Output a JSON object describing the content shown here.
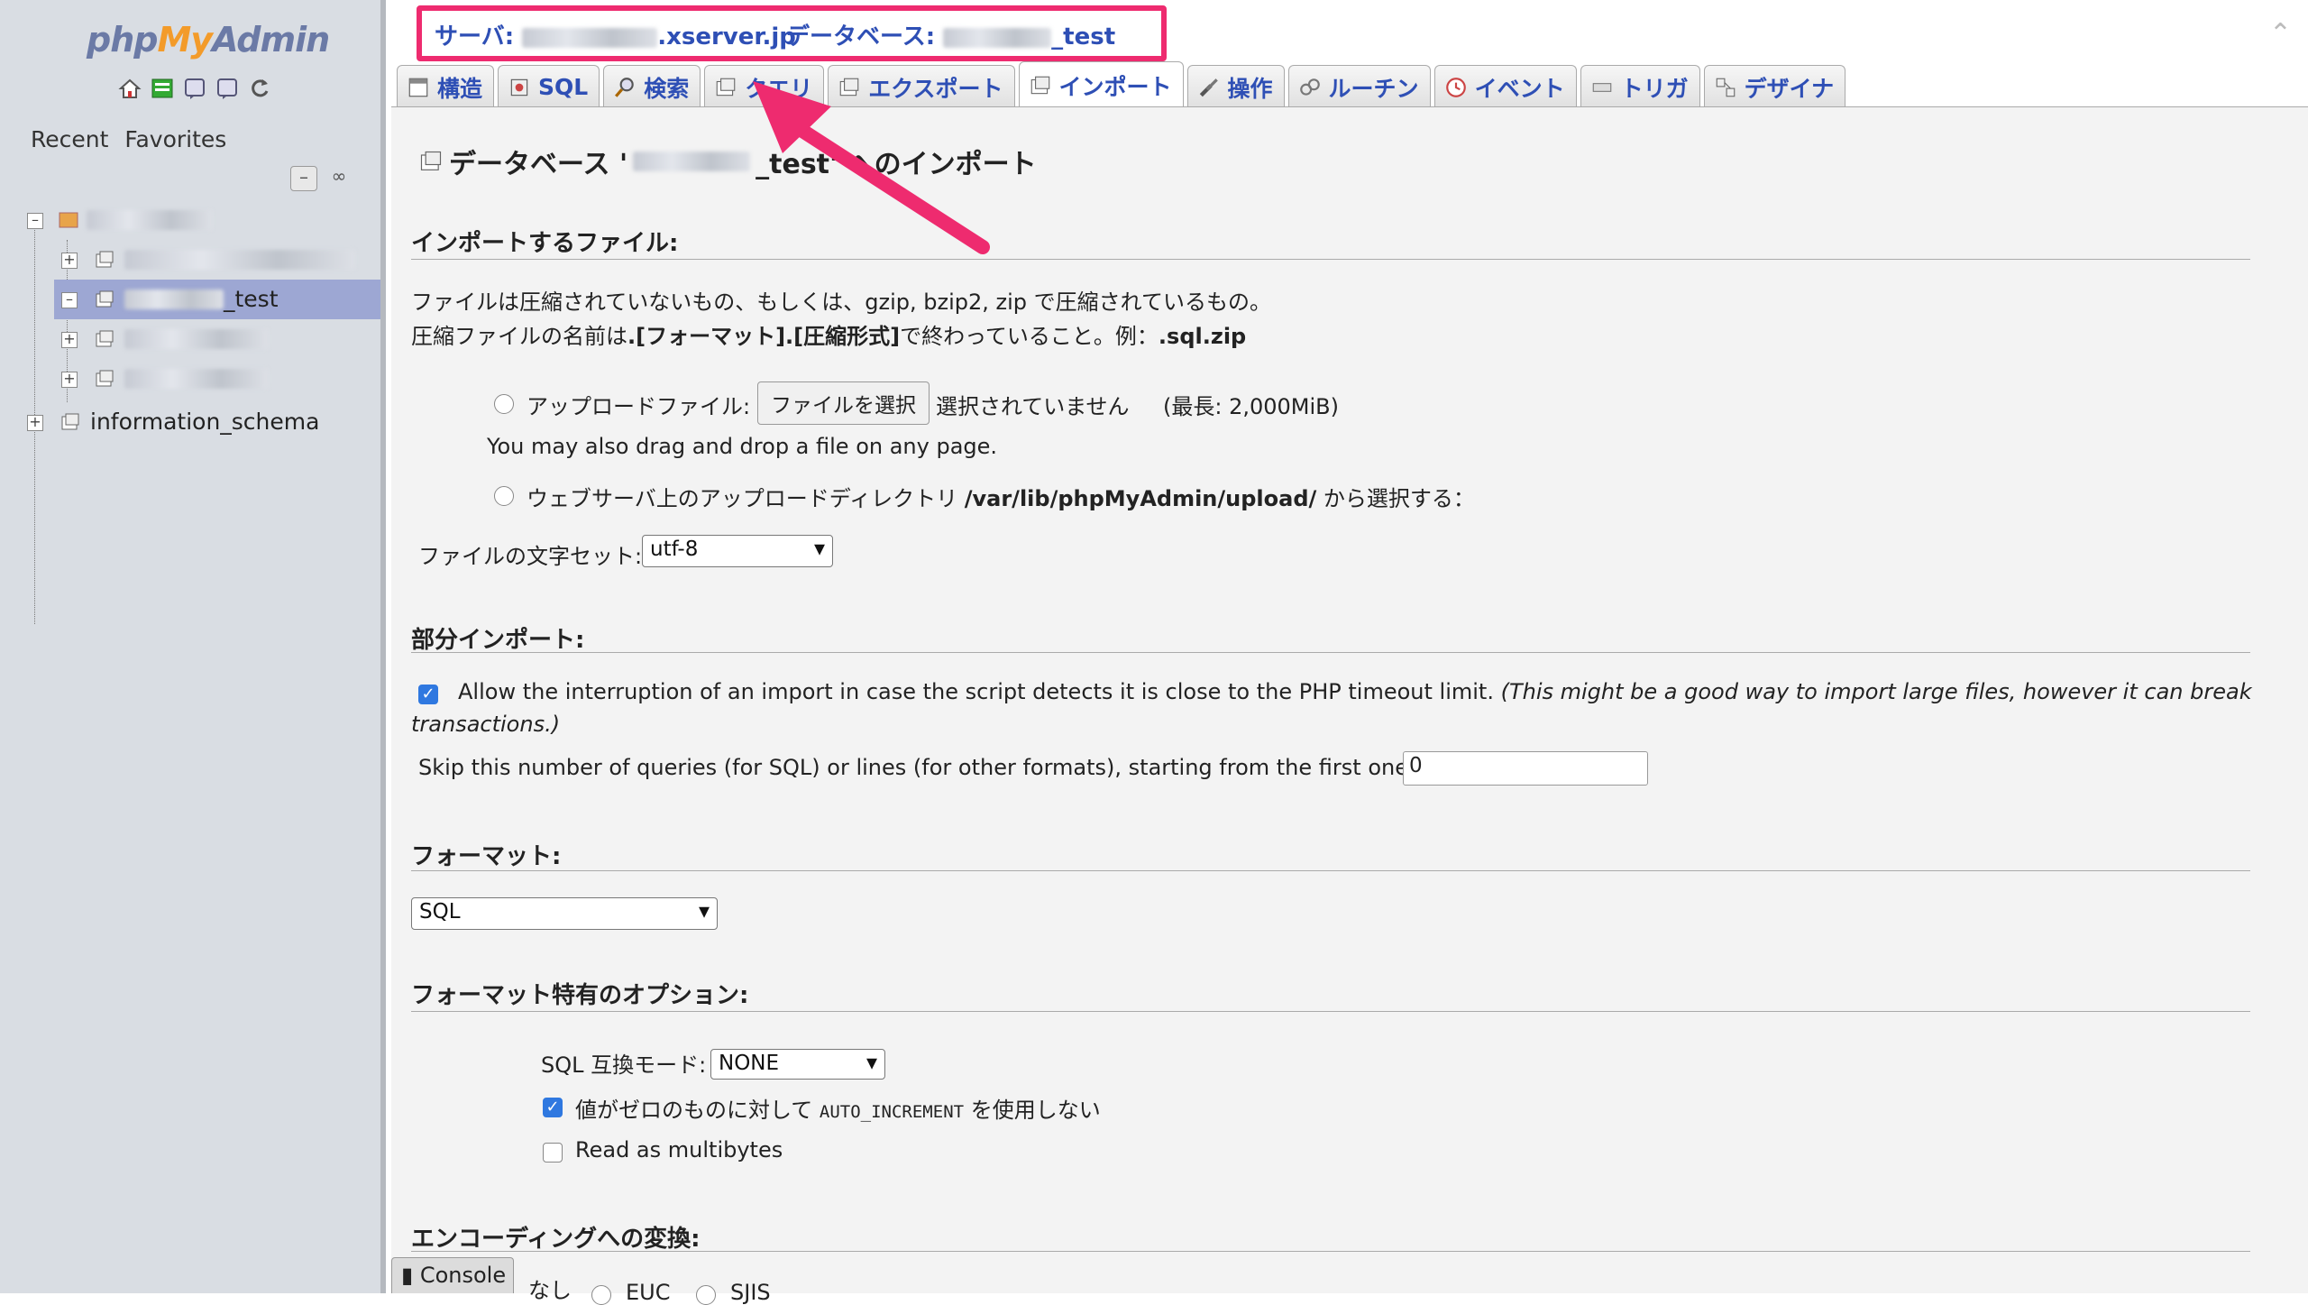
{
  "sidebar": {
    "logo": {
      "php": "php",
      "my": "My",
      "admin": "Admin"
    },
    "nav_icons": [
      "home-icon",
      "sql-query-icon",
      "docs-icon",
      "docs-icon-2",
      "reload-icon"
    ],
    "tabs": {
      "recent": "Recent",
      "favorites": "Favorites"
    },
    "tree": {
      "items": [
        {
          "label": "",
          "blurred": true
        },
        {
          "label": "",
          "blurred": true
        },
        {
          "label": "_test",
          "blurred_prefix": true,
          "selected": true
        },
        {
          "label": "",
          "blurred": true
        },
        {
          "label": "",
          "blurred": true
        },
        {
          "label": "information_schema"
        }
      ]
    }
  },
  "breadcrumb": {
    "server_label": "サーバ: ",
    "server_suffix": ".xserver.jp",
    "db_label": "データベース: ",
    "db_suffix": "_test"
  },
  "tabs": [
    {
      "label": "構造",
      "icon": "structure-icon"
    },
    {
      "label": "SQL",
      "icon": "sql-icon"
    },
    {
      "label": "検索",
      "icon": "search-icon"
    },
    {
      "label": "クエリ",
      "icon": "query-icon"
    },
    {
      "label": "エクスポート",
      "icon": "export-icon"
    },
    {
      "label": "インポート",
      "icon": "import-icon",
      "active": true
    },
    {
      "label": "操作",
      "icon": "operations-icon"
    },
    {
      "label": "ルーチン",
      "icon": "routines-icon"
    },
    {
      "label": "イベント",
      "icon": "events-icon"
    },
    {
      "label": "トリガ",
      "icon": "triggers-icon"
    },
    {
      "label": "デザイナ",
      "icon": "designer-icon"
    }
  ],
  "main": {
    "title_prefix": "データベース '",
    "title_suffix": "_test' へのインポート",
    "file_section": {
      "heading": "インポートするファイル:",
      "line1": "ファイルは圧縮されていないもの、もしくは、gzip, bzip2, zip で圧縮されているもの。",
      "line2_a": "圧縮ファイルの名前は",
      "line2_b": ".[フォーマット].[圧縮形式]",
      "line2_c": "で終わっていること。例：",
      "line2_d": ".sql.zip",
      "upload_label": "アップロードファイル:",
      "choose_file_button": "ファイルを選択",
      "no_file_selected": "選択されていません",
      "max_size": "(最長: 2,000MiB)",
      "drag_drop": "You may also drag and drop a file on any page.",
      "webserver_label_a": "ウェブサーバ上のアップロードディレクトリ",
      "webserver_path": "/var/lib/phpMyAdmin/upload/",
      "webserver_label_b": "から選択する：",
      "charset_label": "ファイルの文字セット:",
      "charset_value": "utf-8"
    },
    "partial_section": {
      "heading": "部分インポート:",
      "allow_interrupt_a": "Allow the interruption of an import in case the script detects it is close to the PHP timeout limit.",
      "allow_interrupt_b": "(This might be a good way to import large files, however it can break",
      "allow_interrupt_c": "transactions.)",
      "allow_interrupt_checked": true,
      "skip_label": "Skip this number of queries (for SQL) or lines (for other formats), starting from the first one:",
      "skip_value": "0"
    },
    "format_section": {
      "heading": "フォーマット:",
      "format_value": "SQL"
    },
    "format_options": {
      "heading": "フォーマット特有のオプション:",
      "compat_label": "SQL 互換モード:",
      "compat_value": "NONE",
      "auto_inc_a": "値がゼロのものに対して ",
      "auto_inc_b": "AUTO_INCREMENT",
      "auto_inc_c": " を使用しない",
      "auto_inc_checked": true,
      "multibytes": "Read as multibytes",
      "multibytes_checked": false
    },
    "encoding_section": {
      "heading": "エンコーディングへの変換:",
      "options": [
        "なし",
        "EUC",
        "SJIS"
      ]
    }
  },
  "console": {
    "label": "Console"
  },
  "colors": {
    "highlight": "#ee2b6f",
    "link": "#2e4fb5",
    "sidebar_bg": "#d9dde3",
    "selected_row": "#9da7d3"
  }
}
